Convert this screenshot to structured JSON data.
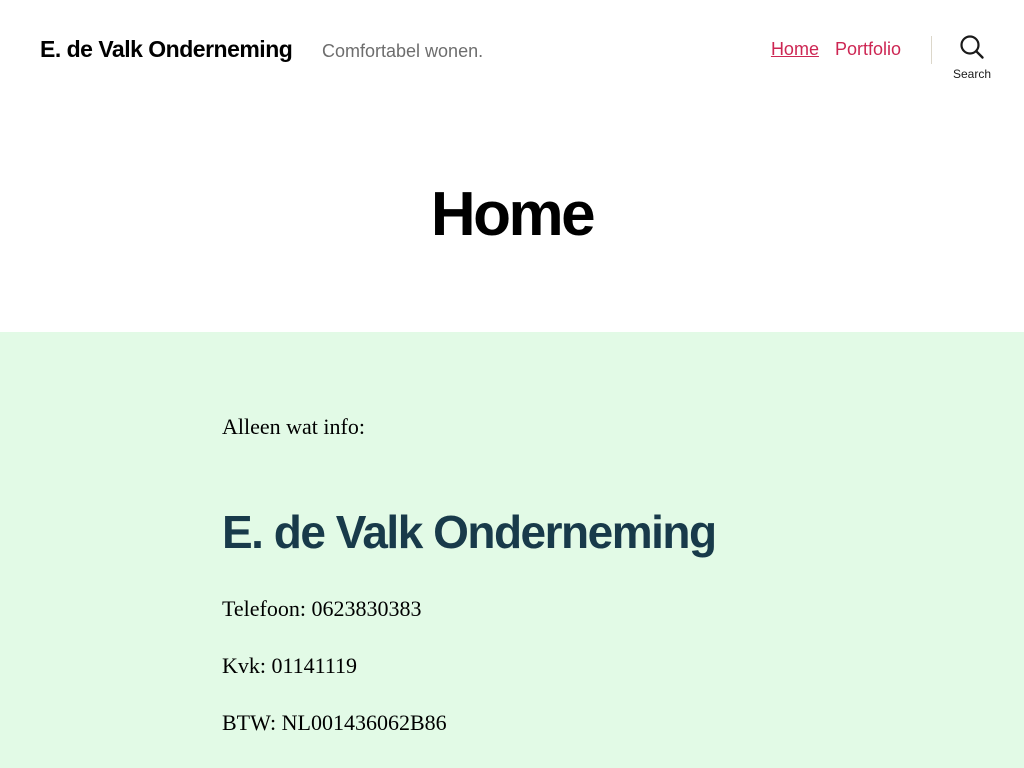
{
  "header": {
    "site_title": "E. de Valk Onderneming",
    "tagline": "Comfortabel wonen.",
    "menu": [
      {
        "label": "Home",
        "current": true
      },
      {
        "label": "Portfolio",
        "current": false
      }
    ],
    "search_label": "Search",
    "search_icon": "search-icon"
  },
  "page": {
    "title": "Home"
  },
  "content": {
    "intro": "Alleen wat info:",
    "company_heading": "E. de Valk Onderneming",
    "phone": "Telefoon: 0623830383",
    "kvk": "Kvk: 01141119",
    "btw": "BTW: NL001436062B86"
  },
  "colors": {
    "accent": "#cd2653",
    "content_background": "#e2fae6",
    "heading": "#183a4a",
    "tagline": "#6d6d6d"
  }
}
